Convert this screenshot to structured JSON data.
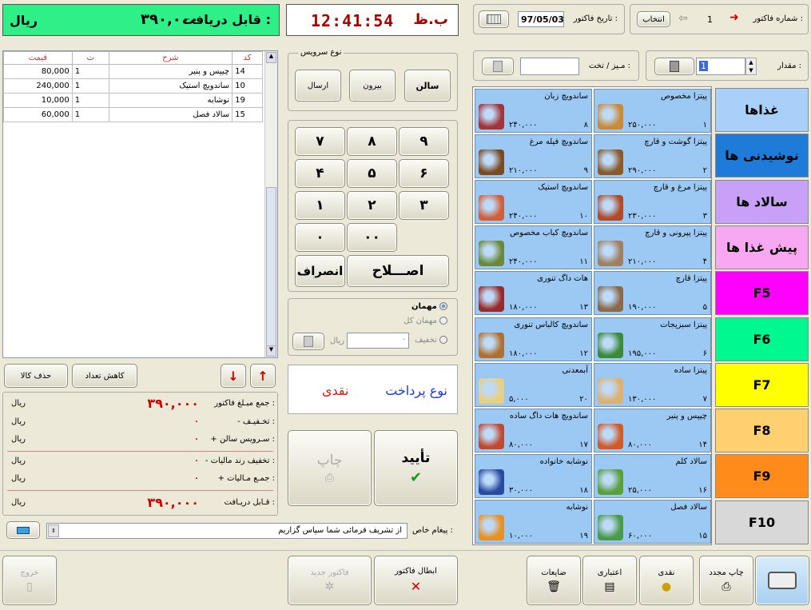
{
  "header": {
    "amount_due_label": "قابل دریافت :",
    "amount_due_value": "۳۹۰,۰۰۰",
    "currency": "ریال",
    "clock": "12:41:54",
    "clock_suffix": "ب.ظ",
    "invoice_date_label": "تاریخ فاکتور :",
    "invoice_date_value": "97/05/03",
    "select_label": "انتخاب",
    "invoice_number_label": "شماره فاکتور :",
    "invoice_number_value": "1"
  },
  "order_table": {
    "headers": [
      "کد",
      "شرح",
      "ت",
      "قیمت"
    ],
    "rows": [
      {
        "code": "14",
        "desc": "چیپس و پنیر",
        "qty": "1",
        "price": "80,000"
      },
      {
        "code": "10",
        "desc": "ساندویچ استیک",
        "qty": "1",
        "price": "240,000"
      },
      {
        "code": "19",
        "desc": "نوشابه",
        "qty": "1",
        "price": "10,000"
      },
      {
        "code": "15",
        "desc": "سالاد فصل",
        "qty": "1",
        "price": "60,000"
      }
    ]
  },
  "service": {
    "title": "نوع سرویس",
    "buttons": [
      "سالن",
      "بیرون",
      "ارسال"
    ]
  },
  "keypad": {
    "rows": [
      [
        "۹",
        "۸",
        "۷"
      ],
      [
        "۶",
        "۵",
        "۴"
      ],
      [
        "۳",
        "۲",
        "۱"
      ]
    ],
    "double_zero": "۰۰",
    "zero": "۰",
    "correct": "اصـــلاح",
    "cancel": "انصراف"
  },
  "discount_panel": {
    "guest": "مهمان",
    "guest_all": "مهمان کل",
    "discount": "تخفیف",
    "currency": "ریال",
    "discount_value": "-"
  },
  "payment": {
    "label": "نوع پرداخت",
    "value": "نقدی"
  },
  "actions": {
    "print": "چاپ",
    "confirm": "تأیید",
    "delete_item": "حذف کالا",
    "reduce_qty": "کاهش تعداد"
  },
  "summary": [
    {
      "label": "جمع مبـلغ فاکتور :",
      "value": "۳۹۰,۰۰۰",
      "currency": "ریال"
    },
    {
      "label": "-   تخـفیـف :",
      "value": "۰",
      "currency": "ریال"
    },
    {
      "label": "+ سـرویس سالن :",
      "value": "۰",
      "currency": "ریال"
    },
    {
      "label": "-  تخفیف رند مالیات :",
      "value": "۰",
      "currency": "ریال"
    },
    {
      "label": "+ جمـع مـالیات :",
      "value": "۰",
      "currency": "ریال"
    },
    {
      "label": "قـابل دریـافت :",
      "value": "۳۹۰,۰۰۰",
      "currency": "ریال"
    }
  ],
  "message": {
    "label": "پیغام خاص :",
    "value": "از تشریف فرمائی شما سپاس گزاریم"
  },
  "right_top": {
    "quantity_label": "مقدار :",
    "quantity_value": "1",
    "table_label": "مـیز / تخت :"
  },
  "categories": [
    {
      "label": "غذاها",
      "color": "#a8d0f8"
    },
    {
      "label": "نوشیدنی ها",
      "color": "#1e7bd8"
    },
    {
      "label": "سالاد ها",
      "color": "#c8a0f8"
    },
    {
      "label": "پیش غذا ها",
      "color": "#f8a8f0"
    },
    {
      "label": "F5",
      "color": "#ff00ff"
    },
    {
      "label": "F6",
      "color": "#00f890"
    },
    {
      "label": "F7",
      "color": "#ffff00"
    },
    {
      "label": "F8",
      "color": "#ffd070"
    },
    {
      "label": "F9",
      "color": "#ff8c1a"
    },
    {
      "label": "F10",
      "color": "#d8d8d8"
    }
  ],
  "products": [
    {
      "name": "پیتزا مخصوص",
      "price": "۲۵۰,۰۰۰",
      "code": "۱",
      "img": "#c98a3a"
    },
    {
      "name": "ساندویچ زبان",
      "price": "۲۴۰,۰۰۰",
      "code": "۸",
      "img": "#a3343a"
    },
    {
      "name": "پیتزا گوشت و قارچ",
      "price": "۲۹۰,۰۰۰",
      "code": "۲",
      "img": "#8a5a2a"
    },
    {
      "name": "ساندویچ فیله مرغ",
      "price": "۲۱۰,۰۰۰",
      "code": "۹",
      "img": "#7a4a20"
    },
    {
      "name": "پیتزا مرغ و قارچ",
      "price": "۲۳۰,۰۰۰",
      "code": "۳",
      "img": "#b04a2a"
    },
    {
      "name": "ساندویچ استیک",
      "price": "۲۴۰,۰۰۰",
      "code": "۱۰",
      "img": "#d0603a"
    },
    {
      "name": "پیتزا پپرونی و قارچ",
      "price": "۲۱۰,۰۰۰",
      "code": "۴",
      "img": "#a08060"
    },
    {
      "name": "ساندویچ کباب مخصوص",
      "price": "۲۴۰,۰۰۰",
      "code": "۱۱",
      "img": "#6a8a3a"
    },
    {
      "name": "پیتزا قارچ",
      "price": "۱۹۰,۰۰۰",
      "code": "۵",
      "img": "#8a6a4a"
    },
    {
      "name": "هات داگ تنوری",
      "price": "۱۸۰,۰۰۰",
      "code": "۱۳",
      "img": "#9a2a2a"
    },
    {
      "name": "پیتزا سبزیجات",
      "price": "۱۹۵,۰۰۰",
      "code": "۶",
      "img": "#3a8a3a"
    },
    {
      "name": "ساندویچ کالباس تنوری",
      "price": "۱۸۰,۰۰۰",
      "code": "۱۲",
      "img": "#b07030"
    },
    {
      "name": "پیتزا ساده",
      "price": "۱۳۰,۰۰۰",
      "code": "۷",
      "img": "#e0b070"
    },
    {
      "name": "آبمعدنی",
      "price": "۵,۰۰۰",
      "code": "۲۰",
      "img": "#e8d080"
    },
    {
      "name": "چیپس و پنیر",
      "price": "۸۰,۰۰۰",
      "code": "۱۴",
      "img": "#d05a2a"
    },
    {
      "name": "ساندویچ هات داگ ساده",
      "price": "۸۰,۰۰۰",
      "code": "۱۷",
      "img": "#c04a30"
    },
    {
      "name": "سالاد کلم",
      "price": "۲۵,۰۰۰",
      "code": "۱۶",
      "img": "#5aa03a"
    },
    {
      "name": "نوشابه خانواده",
      "price": "۳۰,۰۰۰",
      "code": "۱۸",
      "img": "#2a4aa0"
    },
    {
      "name": "سالاد فصل",
      "price": "۶۰,۰۰۰",
      "code": "۱۵",
      "img": "#4a9a4a"
    },
    {
      "name": "نوشابه",
      "price": "۱۰,۰۰۰",
      "code": "۱۹",
      "img": "#e89020"
    }
  ],
  "bottom": {
    "reprint": "چاپ مجدد",
    "cash": "نقدی",
    "credit": "اعتباری",
    "waste": "ضایعات",
    "void_invoice": "ابطال فاکتور",
    "new_invoice": "فاکتور جدید",
    "exit": "خروج"
  }
}
